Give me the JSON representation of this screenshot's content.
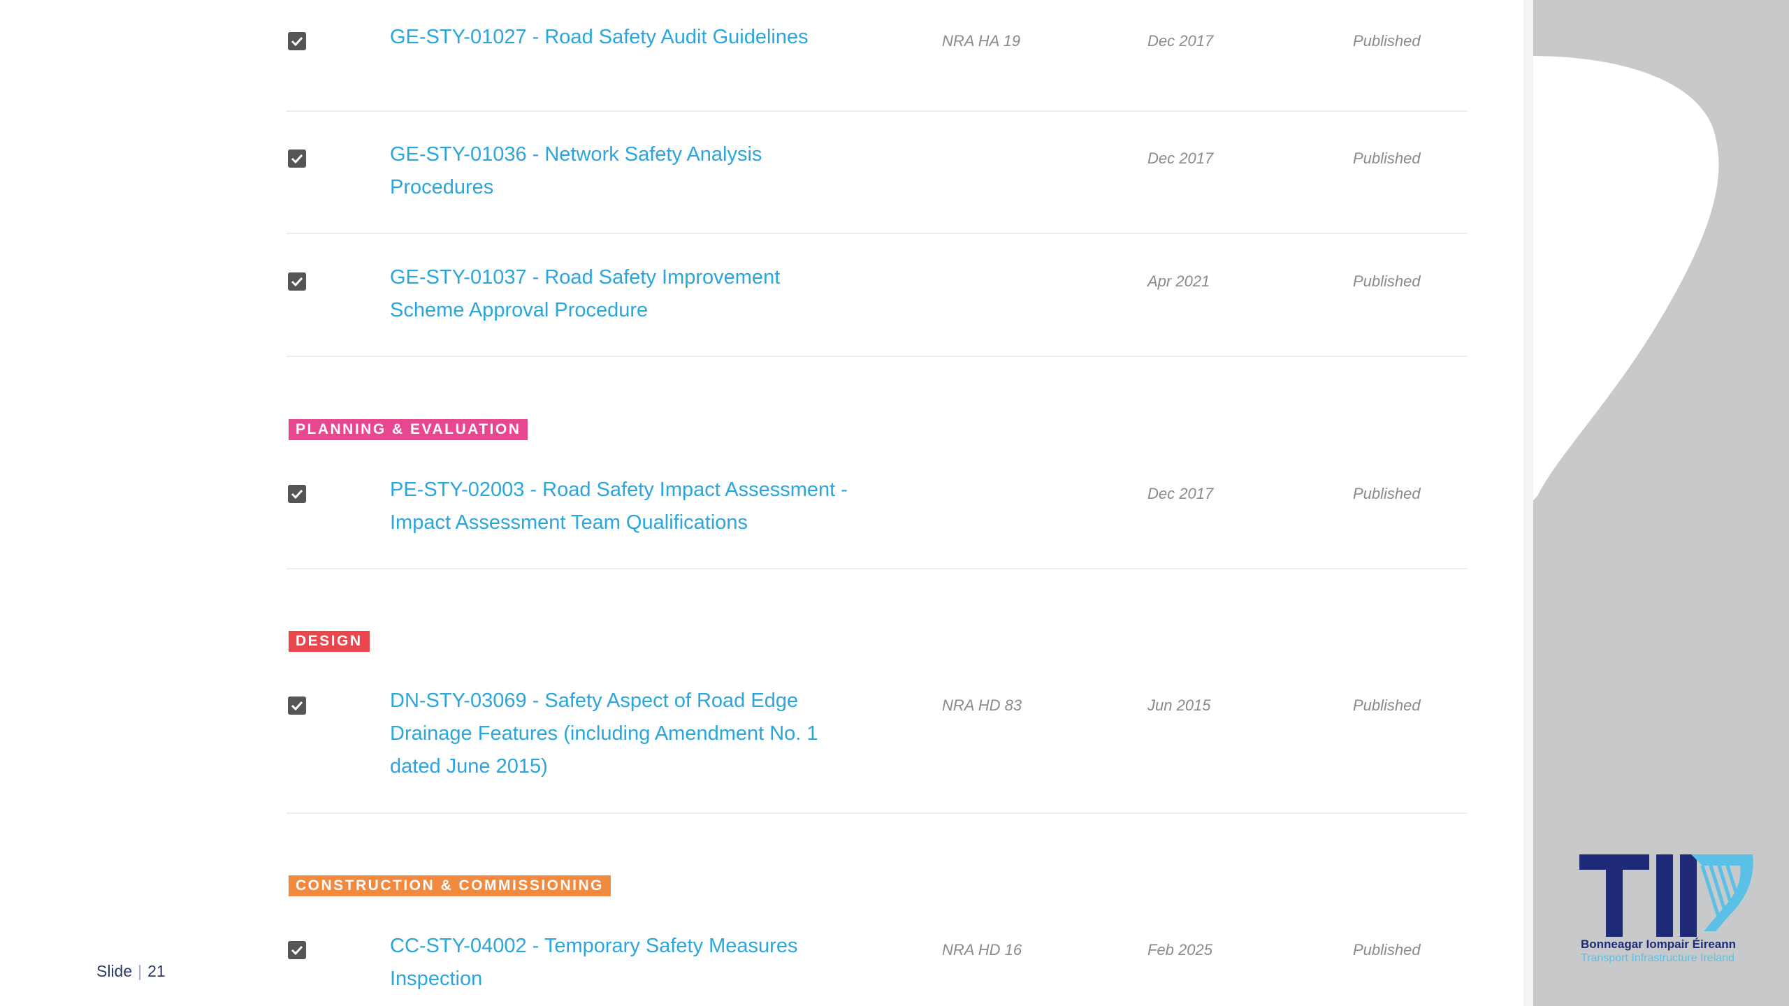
{
  "colors": {
    "link": "#2aa6dc",
    "planning_badge": "#e8468f",
    "design_badge": "#e9474d",
    "construction_badge": "#f18a3f"
  },
  "rows": [
    {
      "title_lines": [
        "GE-STY-01027 - Road Safety Audit Guidelines"
      ],
      "ref": "NRA HA 19",
      "date": "Dec 2017",
      "status": "Published"
    },
    {
      "title_lines": [
        "GE-STY-01036 - Network Safety Analysis",
        "Procedures"
      ],
      "ref": "",
      "date": "Dec 2017",
      "status": "Published"
    },
    {
      "title_lines": [
        "GE-STY-01037 - Road Safety Improvement",
        "Scheme Approval Procedure"
      ],
      "ref": "",
      "date": "Apr 2021",
      "status": "Published"
    },
    {
      "title_lines": [
        "PE-STY-02003 - Road Safety Impact Assessment -",
        "Impact Assessment Team Qualifications"
      ],
      "ref": "",
      "date": "Dec 2017",
      "status": "Published"
    },
    {
      "title_lines": [
        "DN-STY-03069 - Safety Aspect of Road Edge",
        "Drainage Features (including Amendment No. 1",
        "dated June 2015)"
      ],
      "ref": "NRA HD 83",
      "date": "Jun 2015",
      "status": "Published"
    },
    {
      "title_lines": [
        "CC-STY-04002 - Temporary Safety Measures",
        "Inspection"
      ],
      "ref": "NRA HD 16",
      "date": "Feb 2025",
      "status": "Published"
    }
  ],
  "sections": {
    "planning": "PLANNING & EVALUATION",
    "design": "DESIGN",
    "construction": "CONSTRUCTION & COMMISSIONING"
  },
  "footer": {
    "slide_label": "Slide",
    "slide_number": "21"
  },
  "logo": {
    "text_irish": "Bonneagar Iompair Éireann",
    "text_english": "Transport Infrastructure Ireland",
    "icon": "tii-harp-logo"
  }
}
